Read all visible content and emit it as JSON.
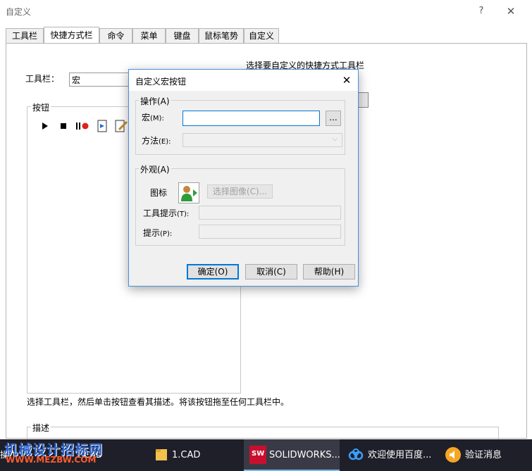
{
  "window": {
    "title": "自定义",
    "help": "?",
    "close": "✕"
  },
  "tabs": [
    {
      "label": "工具栏"
    },
    {
      "label": "快捷方式栏"
    },
    {
      "label": "命令"
    },
    {
      "label": "菜单"
    },
    {
      "label": "键盘"
    },
    {
      "label": "鼠标笔势"
    },
    {
      "label": "自定义"
    }
  ],
  "panel": {
    "toolbar_label": "工具栏：",
    "toolbar_value": "宏",
    "choose_toolbar_label": "选择要自定义的快捷方式工具栏",
    "buttons_group": "按钮",
    "hint": "选择工具栏，然后单击按钮查看其描述。将该按钮拖至任何工具栏中。",
    "description_group": "描述"
  },
  "macro_icons": [
    "play-icon",
    "stop-icon",
    "pause-record-icon",
    "new-macro-icon",
    "edit-macro-icon"
  ],
  "dialog": {
    "title": "自定义宏按钮",
    "close": "✕",
    "operation_group": "操作(A)",
    "macro_label": "宏",
    "macro_key": "(M):",
    "macro_value": "",
    "browse_label": "...",
    "method_label": "方法",
    "method_key": "(E):",
    "appearance_group": "外观(A)",
    "icon_label": "图标",
    "choose_image": "选择图像(C)...",
    "tooltip_label": "工具提示",
    "tooltip_key": "(T):",
    "prompt_label": "提示",
    "prompt_key": "(P):",
    "ok": "确定(O)",
    "cancel": "取消(C)",
    "help": "帮助(H)"
  },
  "taskbar": {
    "items": [
      {
        "label": "1.CAD",
        "icon": "folder-icon"
      },
      {
        "label": "SOLIDWORKS...",
        "icon": "solidworks-icon"
      },
      {
        "label": "欢迎使用百度...",
        "icon": "baidu-cloud-icon"
      },
      {
        "label": "验证消息",
        "icon": "speaker-icon"
      }
    ],
    "left_partial": "操作",
    "left_partial2": "1.CAD"
  },
  "watermark": {
    "line1": "机械设计招标网",
    "line2": "WWW.MEZBW.COM"
  }
}
